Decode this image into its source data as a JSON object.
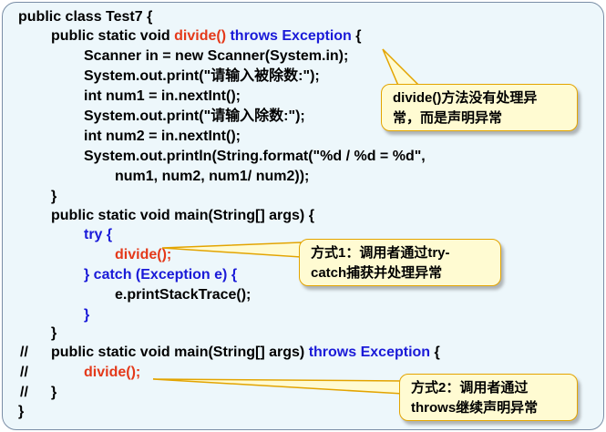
{
  "code": {
    "l1": {
      "a": "public class Test7 {"
    },
    "l2": {
      "a": "public static void ",
      "b": "divide()",
      "c": " throws Exception",
      "d": " {"
    },
    "l3": {
      "a": "Scanner in = new Scanner(System.in);"
    },
    "l4": {
      "a": "System.out.print(\"请输入被除数:\");"
    },
    "l5": {
      "a": "int num1 = in.nextInt();"
    },
    "l6": {
      "a": "System.out.print(\"请输入除数:\");"
    },
    "l7": {
      "a": "int num2 = in.nextInt();"
    },
    "l8": {
      "a": "System.out.println(String.format(\"%d / %d = %d\","
    },
    "l9": {
      "a": "num1, num2, num1/ num2));"
    },
    "l10": {
      "a": "}"
    },
    "l11": {
      "a": "public static void main(String[] args) {"
    },
    "l12": {
      "a": "try {"
    },
    "l13": {
      "a": "divide();"
    },
    "l14": {
      "a": "} catch (Exception e) {"
    },
    "l15": {
      "a": "e.printStackTrace();"
    },
    "l16": {
      "a": "}"
    },
    "l17": {
      "a": "}"
    },
    "l18": {
      "m": "//",
      "a": "public static void main(String[] args) ",
      "b": "throws Exception",
      "c": " {"
    },
    "l19": {
      "m": "//",
      "a": "divide();"
    },
    "l20": {
      "m": "//",
      "a": "}"
    },
    "l21": {
      "a": "}"
    }
  },
  "notes": {
    "n1": {
      "line1": "divide()方法没有处理异",
      "line2": "常，而是声明异常"
    },
    "n2": {
      "line1": "方式1：调用者通过try-",
      "line2": "catch捕获并处理异常"
    },
    "n3": {
      "line1": "方式2：调用者通过",
      "line2": "throws继续声明异常"
    }
  },
  "colors": {
    "keyword_blue": "#1a1ad8",
    "method_red": "#e4391a",
    "note_bg": "#fffbd2",
    "note_border": "#e3a400"
  }
}
